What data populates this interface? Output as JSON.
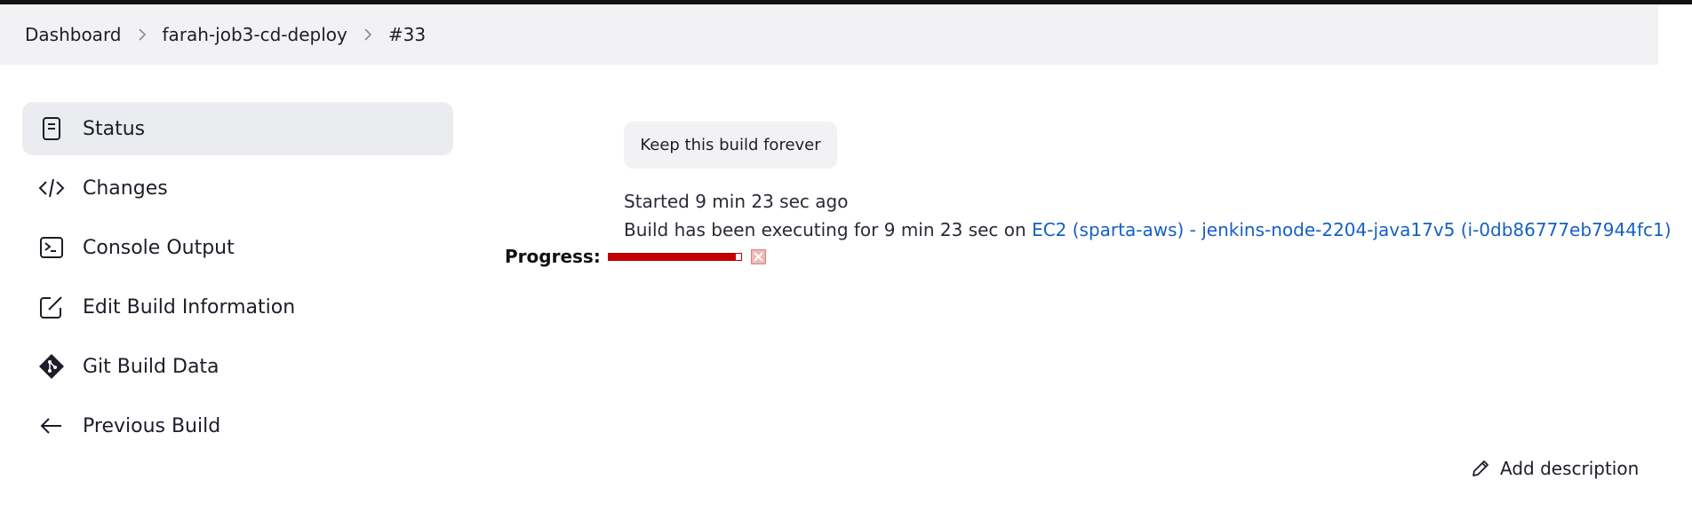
{
  "breadcrumb": {
    "items": [
      "Dashboard",
      "farah-job3-cd-deploy",
      "#33"
    ]
  },
  "sidebar": {
    "items": [
      {
        "label": "Status",
        "icon": "document-icon"
      },
      {
        "label": "Changes",
        "icon": "code-icon"
      },
      {
        "label": "Console Output",
        "icon": "terminal-icon"
      },
      {
        "label": "Edit Build Information",
        "icon": "edit-icon"
      },
      {
        "label": "Git Build Data",
        "icon": "git-icon"
      },
      {
        "label": "Previous Build",
        "icon": "arrow-left-icon"
      }
    ]
  },
  "main": {
    "keep_button": "Keep this build forever",
    "started": "Started 9 min 23 sec ago",
    "executing_prefix": "Build has been executing for 9 min 23 sec on ",
    "node_link": "EC2 (sparta-aws) - jenkins-node-2204-java17v5 (i-0db86777eb7944fc1)",
    "progress_label": "Progress:",
    "progress_fraction": 0.96,
    "add_description": "Add description"
  },
  "colors": {
    "link": "#1560c4",
    "progress": "#c40000",
    "active_item_bg": "#ebecf0"
  }
}
